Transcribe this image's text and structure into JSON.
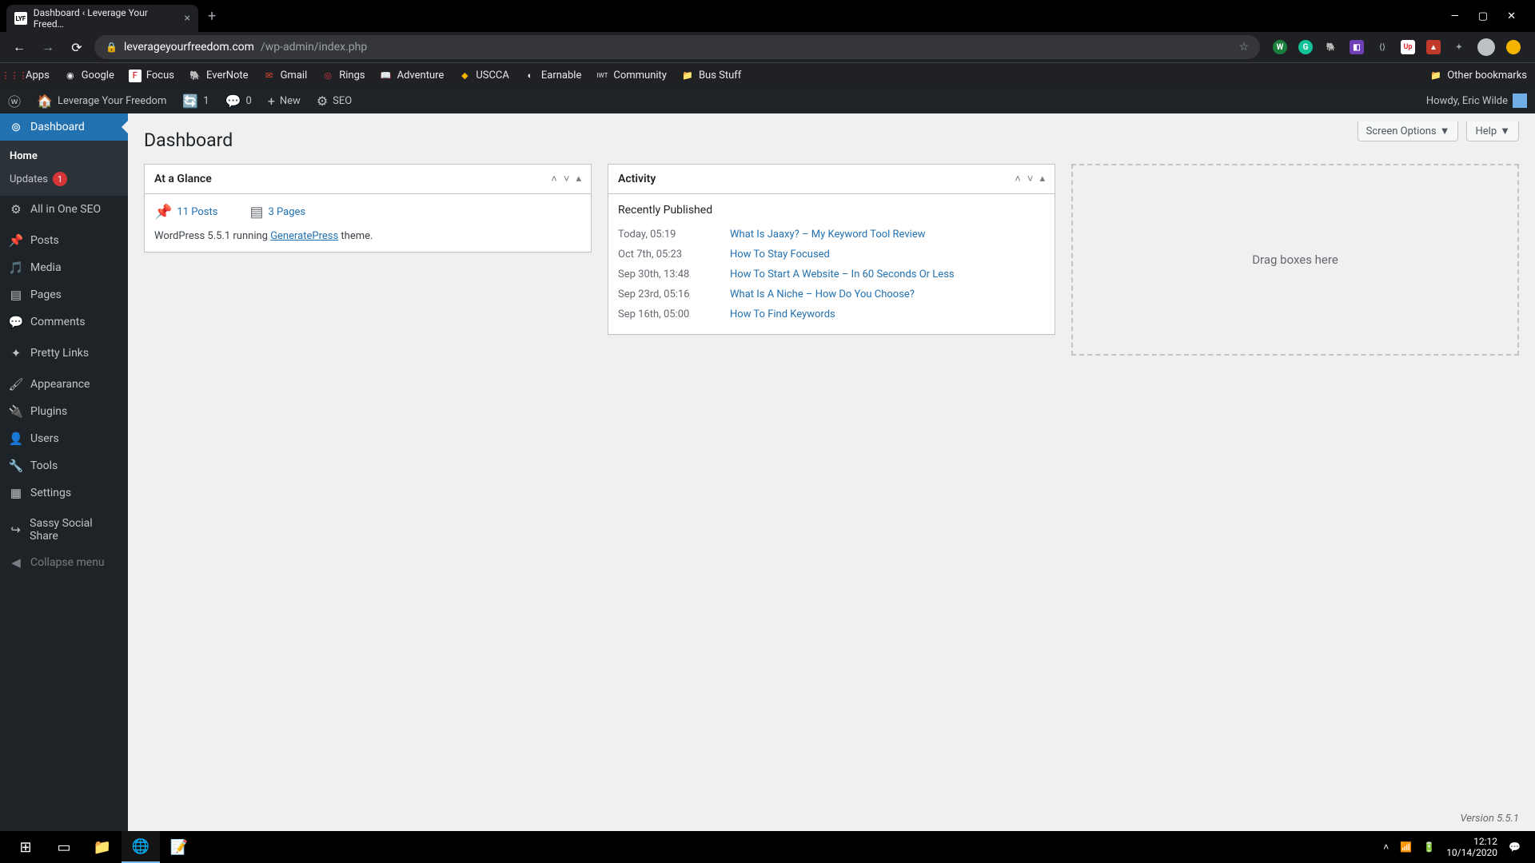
{
  "browser": {
    "tab_title": "Dashboard ‹ Leverage Your Freed…",
    "url_domain": "leverageyourfreedom.com",
    "url_path": "/wp-admin/index.php",
    "bookmarks": [
      "Apps",
      "Google",
      "Focus",
      "EverNote",
      "Gmail",
      "Rings",
      "Adventure",
      "USCCA",
      "Earnable",
      "Community",
      "Bus Stuff"
    ],
    "other_bookmarks": "Other bookmarks"
  },
  "adminbar": {
    "site_name": "Leverage Your Freedom",
    "updates": "1",
    "comments": "0",
    "new": "New",
    "seo": "SEO",
    "howdy": "Howdy, Eric Wilde"
  },
  "sidebar": {
    "dashboard": "Dashboard",
    "home": "Home",
    "updates": "Updates",
    "updates_count": "1",
    "all_in_one_seo": "All in One SEO",
    "posts": "Posts",
    "media": "Media",
    "pages": "Pages",
    "comments": "Comments",
    "pretty_links": "Pretty Links",
    "appearance": "Appearance",
    "plugins": "Plugins",
    "users": "Users",
    "tools": "Tools",
    "settings": "Settings",
    "sassy": "Sassy Social Share",
    "collapse": "Collapse menu"
  },
  "page": {
    "title": "Dashboard",
    "screen_options": "Screen Options",
    "help": "Help",
    "version": "Version 5.5.1"
  },
  "glance": {
    "title": "At a Glance",
    "posts": "11 Posts",
    "pages": "3 Pages",
    "wp_running_pre": "WordPress 5.5.1 running ",
    "theme": "GeneratePress",
    "wp_running_post": " theme."
  },
  "activity": {
    "title": "Activity",
    "section": "Recently Published",
    "items": [
      {
        "date": "Today, 05:19",
        "title": "What Is Jaaxy? – My Keyword Tool Review"
      },
      {
        "date": "Oct 7th, 05:23",
        "title": "How To Stay Focused"
      },
      {
        "date": "Sep 30th, 13:48",
        "title": "How To Start A Website – In 60 Seconds Or Less"
      },
      {
        "date": "Sep 23rd, 05:16",
        "title": "What Is A Niche – How Do You Choose?"
      },
      {
        "date": "Sep 16th, 05:00",
        "title": "How To Find Keywords"
      }
    ]
  },
  "dropzone": "Drag boxes here",
  "taskbar": {
    "time": "12:12",
    "date": "10/14/2020"
  }
}
